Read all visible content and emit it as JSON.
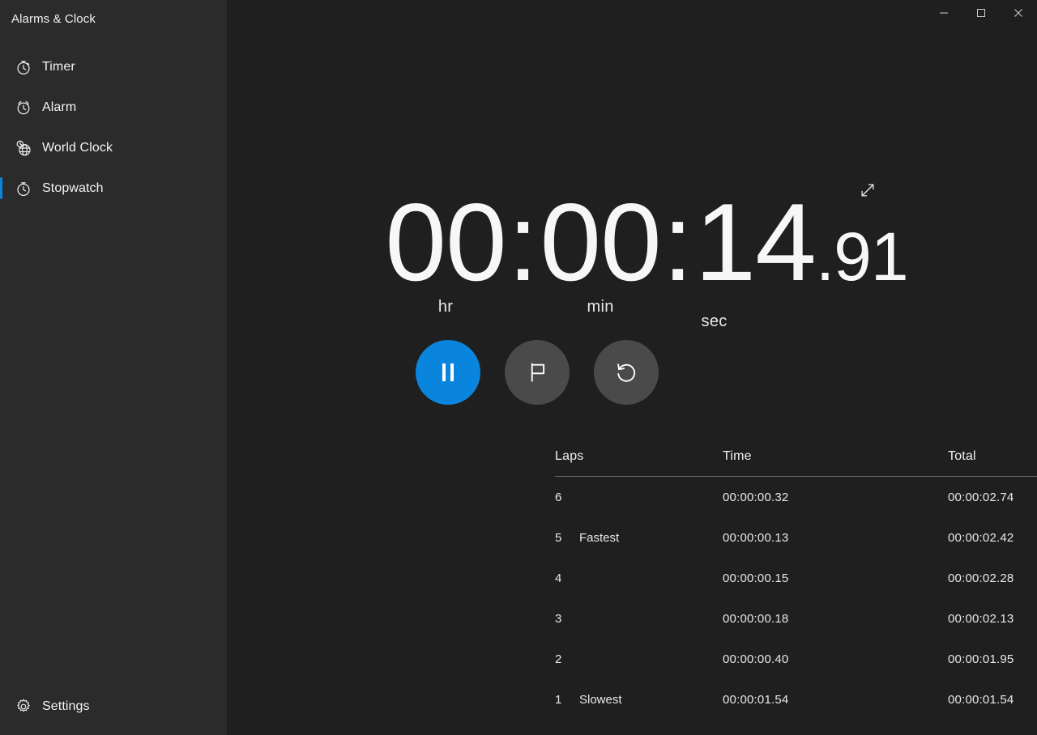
{
  "window": {
    "title": "Alarms & Clock",
    "controls": [
      {
        "name": "minimize-button",
        "icon": "minimize-icon",
        "label": "Minimize"
      },
      {
        "name": "maximize-button",
        "icon": "maximize-icon",
        "label": "Maximize"
      },
      {
        "name": "close-button",
        "icon": "close-icon",
        "label": "Close"
      }
    ]
  },
  "colors": {
    "accent": "#0a85dd",
    "sidebar_bg": "#2b2b2b",
    "main_bg": "#1f1f1f",
    "button_secondary": "#4a4a4a",
    "text": "#f2f2f2",
    "divider": "#6a6a6a"
  },
  "sidebar": {
    "items": [
      {
        "label": "Timer",
        "icon": "timer-icon",
        "selected": false
      },
      {
        "label": "Alarm",
        "icon": "alarm-icon",
        "selected": false
      },
      {
        "label": "World Clock",
        "icon": "world-clock-icon",
        "selected": false
      },
      {
        "label": "Stopwatch",
        "icon": "stopwatch-icon",
        "selected": true
      }
    ],
    "settings": {
      "label": "Settings",
      "icon": "gear-icon"
    }
  },
  "stopwatch": {
    "expand_icon": "expand-diagonal-icon",
    "display": {
      "hours": "00",
      "minutes": "00",
      "seconds": "14",
      "fraction": ".91",
      "separator": ":",
      "unit_hours": "hr",
      "unit_minutes": "min",
      "unit_seconds": "sec",
      "full_value": "00:00:14.91"
    },
    "controls": [
      {
        "name": "pause-button",
        "icon": "pause-icon",
        "label": "Pause",
        "style": "primary"
      },
      {
        "name": "lap-button",
        "icon": "flag-icon",
        "label": "Lap",
        "style": "secondary"
      },
      {
        "name": "reset-button",
        "icon": "reset-icon",
        "label": "Reset",
        "style": "secondary"
      }
    ],
    "laps_table": {
      "headers": {
        "lap": "Laps",
        "time": "Time",
        "total": "Total"
      },
      "rows": [
        {
          "lap": "6",
          "tag": "",
          "time": "00:00:00.32",
          "total": "00:00:02.74"
        },
        {
          "lap": "5",
          "tag": "Fastest",
          "time": "00:00:00.13",
          "total": "00:00:02.42"
        },
        {
          "lap": "4",
          "tag": "",
          "time": "00:00:00.15",
          "total": "00:00:02.28"
        },
        {
          "lap": "3",
          "tag": "",
          "time": "00:00:00.18",
          "total": "00:00:02.13"
        },
        {
          "lap": "2",
          "tag": "",
          "time": "00:00:00.40",
          "total": "00:00:01.95"
        },
        {
          "lap": "1",
          "tag": "Slowest",
          "time": "00:00:01.54",
          "total": "00:00:01.54"
        }
      ]
    }
  }
}
